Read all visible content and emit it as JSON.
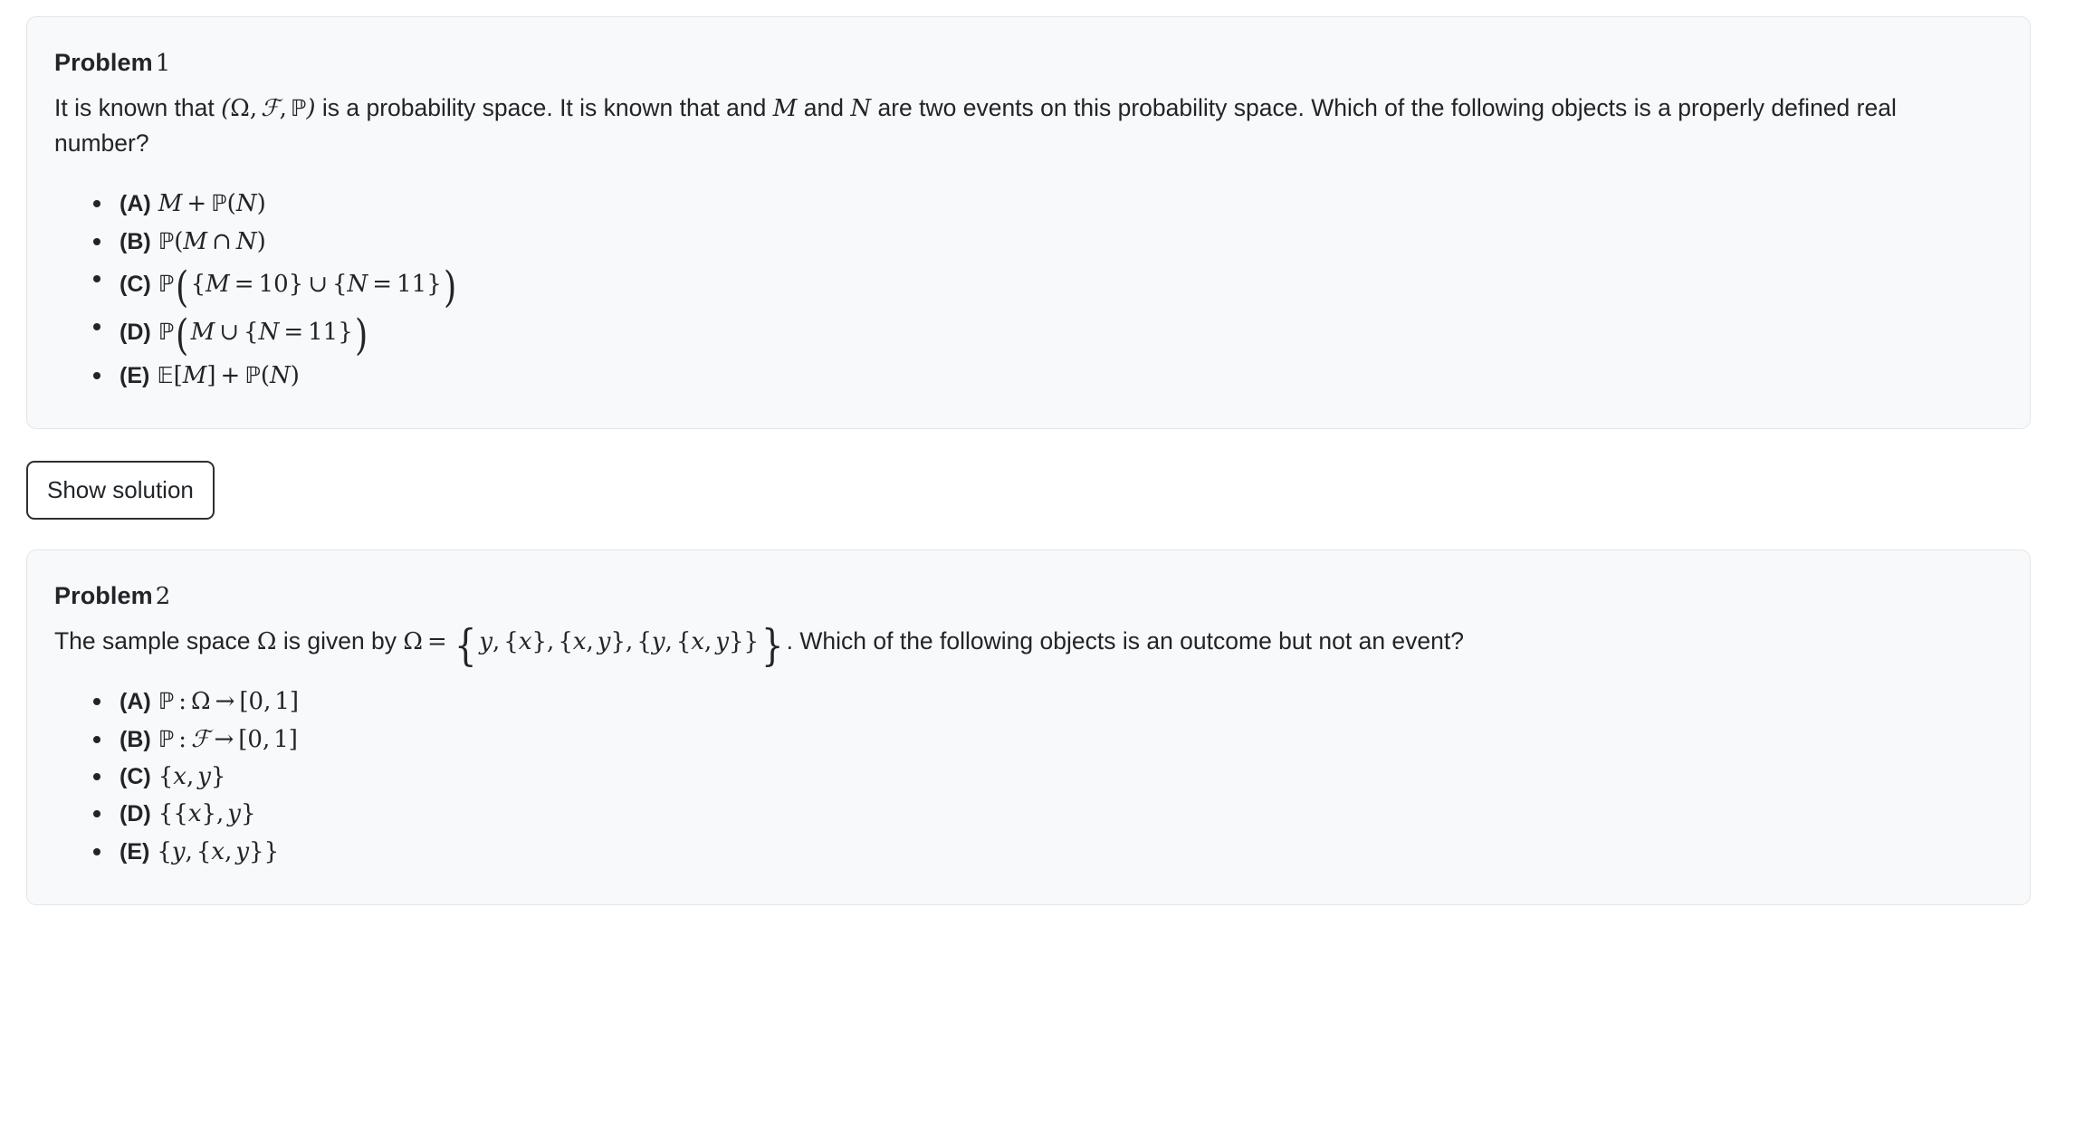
{
  "page": {
    "background": "#ffffff",
    "card_background": "#f8f9fa",
    "card_border": "#e3e5e8",
    "text_color": "#212529"
  },
  "problems": [
    {
      "label": "Problem",
      "number": "1",
      "statement_part1": "It is known that ",
      "math_triple": "(Ω, 𝓕, ℙ)",
      "statement_part2": " is a probability space. It is known that and ",
      "var_m": "M",
      "statement_part3": " and ",
      "var_n": "N",
      "statement_part4": " are two events on this probability space. Which of the following objects is a properly defined real number?",
      "options": [
        {
          "key": "(A)",
          "math": "M + ℙ(N)"
        },
        {
          "key": "(B)",
          "math": "ℙ(M ∩ N)"
        },
        {
          "key": "(C)",
          "math": "ℙ({M = 10} ∪ {N = 11})"
        },
        {
          "key": "(D)",
          "math": "ℙ(M ∪ {N = 11})"
        },
        {
          "key": "(E)",
          "math": "𝔼[M] + ℙ(N)"
        }
      ]
    },
    {
      "label": "Problem",
      "number": "2",
      "statement_part1": "The sample space ",
      "omega": "Ω",
      "statement_part2": " is given by ",
      "omega_eq": "Ω =",
      "sample_space_set": "{y, {x}, {x, y}, {y, {x, y}}}",
      "statement_part3": ". Which of the following objects is an outcome but not an event?",
      "options": [
        {
          "key": "(A)",
          "math": "ℙ : Ω → [0, 1]"
        },
        {
          "key": "(B)",
          "math": "ℙ : 𝓕 → [0, 1]"
        },
        {
          "key": "(C)",
          "math": "{x, y}"
        },
        {
          "key": "(D)",
          "math": "{{x}, y}"
        },
        {
          "key": "(E)",
          "math": "{y, {x, y}}"
        }
      ]
    }
  ],
  "buttons": {
    "show_solution": "Show solution"
  }
}
